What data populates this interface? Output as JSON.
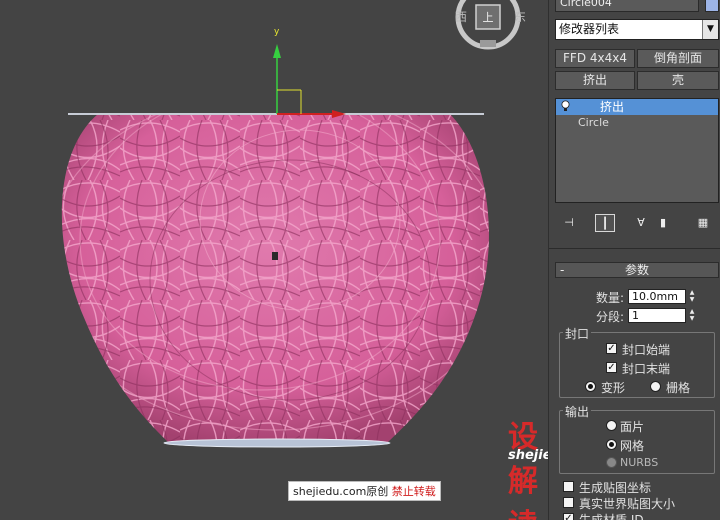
{
  "viewport": {
    "axis_y_label": "y",
    "watermark_site": "shejiedu.com",
    "watermark_mid": "原创",
    "watermark_red": "禁止转载",
    "watermark_logo": "设解读",
    "watermark_url": "shejiedu.com"
  },
  "panel": {
    "object_name": "Circle004",
    "modifier_list": "修改器列表",
    "buttons": {
      "ffd": "FFD 4x4x4",
      "chamfer_section": "倒角剖面",
      "extrude": "挤出",
      "shell": "壳"
    },
    "stack": [
      {
        "label": "挤出"
      },
      {
        "label": "Circle"
      }
    ],
    "params": {
      "title": "参数",
      "collapse": "-",
      "amount_label": "数量:",
      "amount_value": "10.0mm",
      "segments_label": "分段:",
      "segments_value": "1",
      "capping_title": "封口",
      "cap_start": "封口始端",
      "cap_end": "封口末端",
      "morph": "变形",
      "grid": "栅格",
      "output_title": "输出",
      "patch": "面片",
      "mesh": "网格",
      "nurbs": "NURBS",
      "gen_mapping": "生成贴图坐标",
      "real_world": "真实世界贴图大小",
      "gen_material": "生成材质 ID"
    }
  },
  "colors": {
    "vase": "#d6609a",
    "selection": "#5591d6"
  }
}
